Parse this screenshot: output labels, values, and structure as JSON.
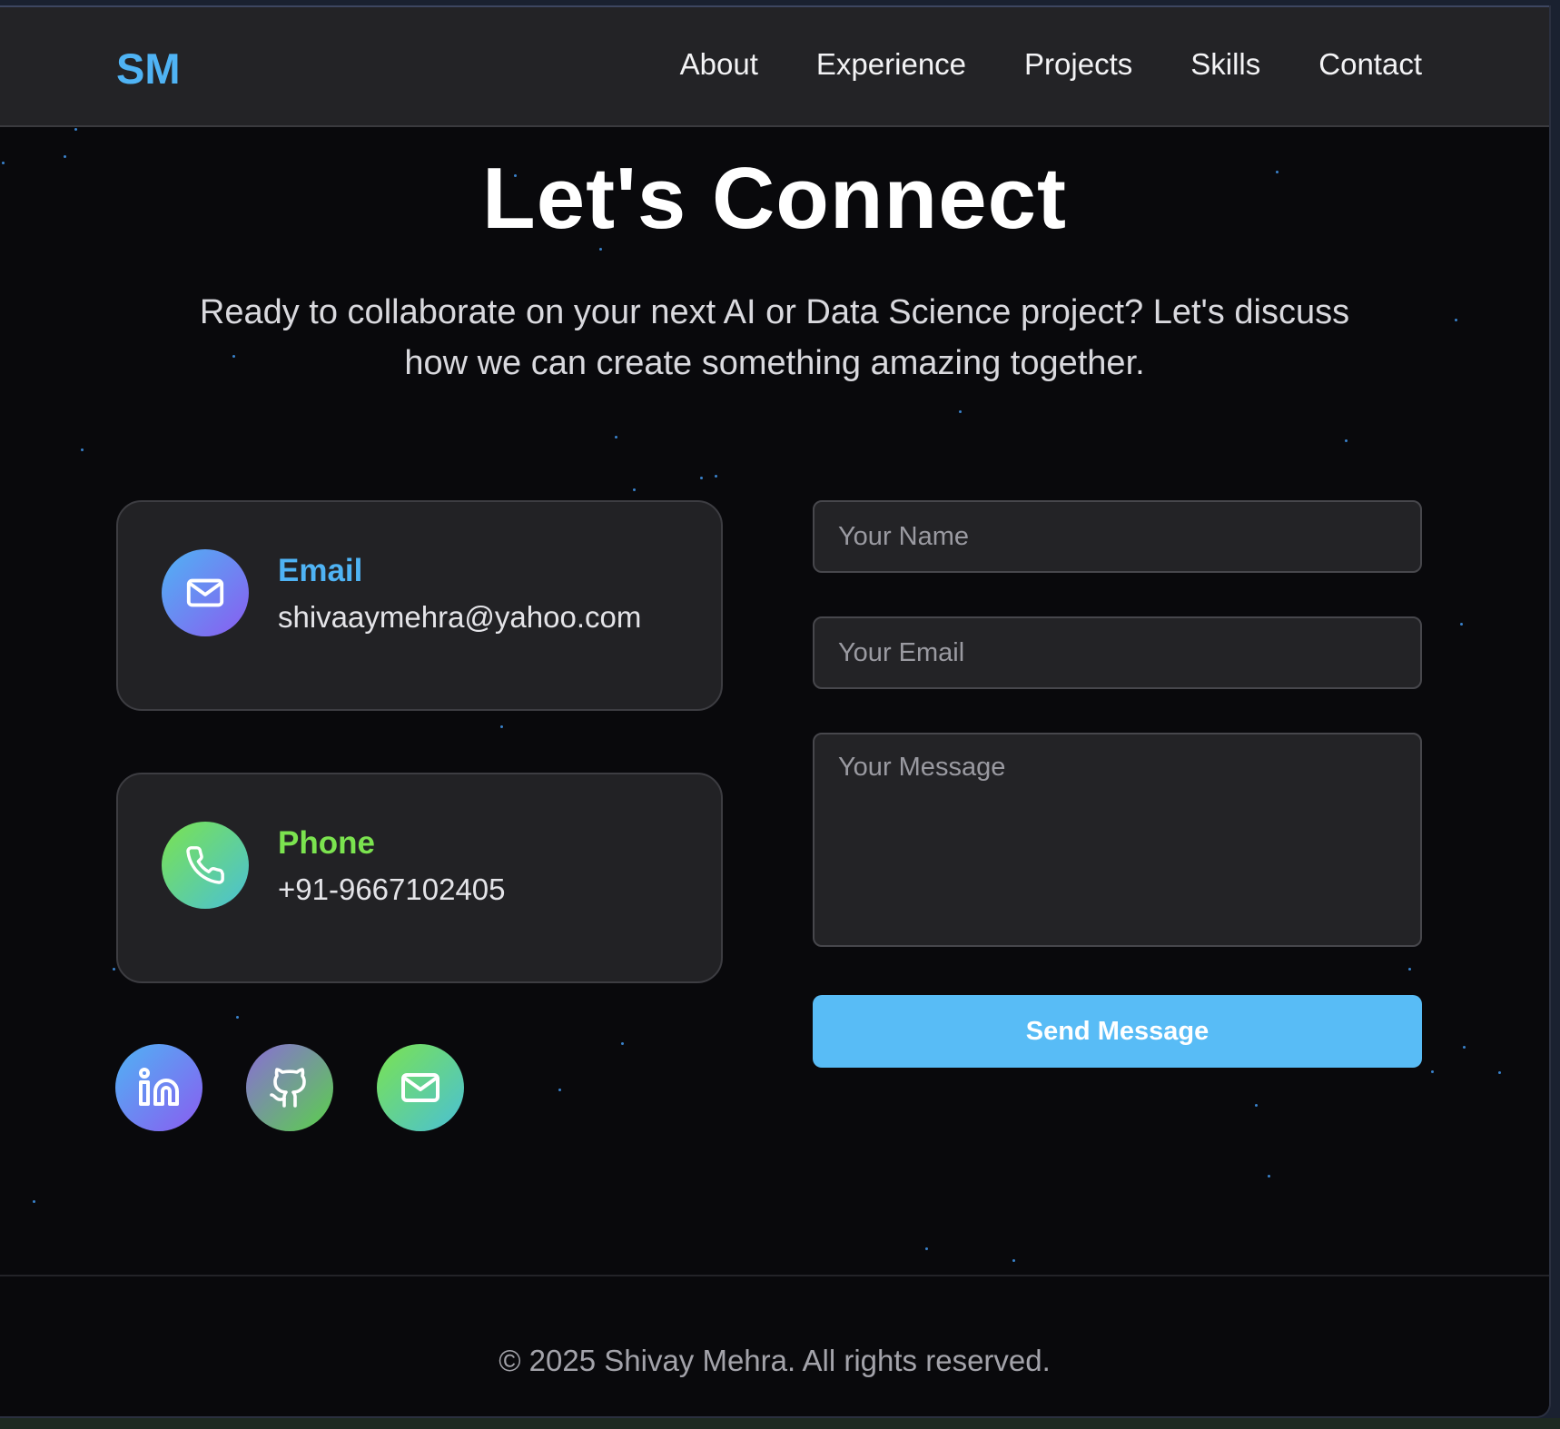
{
  "header": {
    "logo": "SM",
    "nav": [
      "About",
      "Experience",
      "Projects",
      "Skills",
      "Contact"
    ]
  },
  "hero": {
    "title": "Let's Connect",
    "subtitle": "Ready to collaborate on your next AI or Data Science project? Let's discuss how we can create something amazing together."
  },
  "contact_cards": [
    {
      "title": "Email",
      "value": "shivaaymehra@yahoo.com",
      "icon": "mail-icon",
      "accent": "#4fb3f4"
    },
    {
      "title": "Phone",
      "value": "+91-9667102405",
      "icon": "phone-icon",
      "accent": "#7be34f"
    }
  ],
  "socials": [
    {
      "name": "linkedin-icon"
    },
    {
      "name": "github-icon"
    },
    {
      "name": "mail-icon"
    }
  ],
  "form": {
    "name_placeholder": "Your Name",
    "email_placeholder": "Your Email",
    "message_placeholder": "Your Message",
    "submit_label": "Send Message"
  },
  "footer": {
    "copyright": "© 2025 Shivay Mehra. All rights reserved."
  },
  "colors": {
    "accent_blue": "#4fb3f4",
    "accent_green": "#7be34f",
    "button": "#58bcf6",
    "background": "#09090c",
    "card": "#222225"
  }
}
